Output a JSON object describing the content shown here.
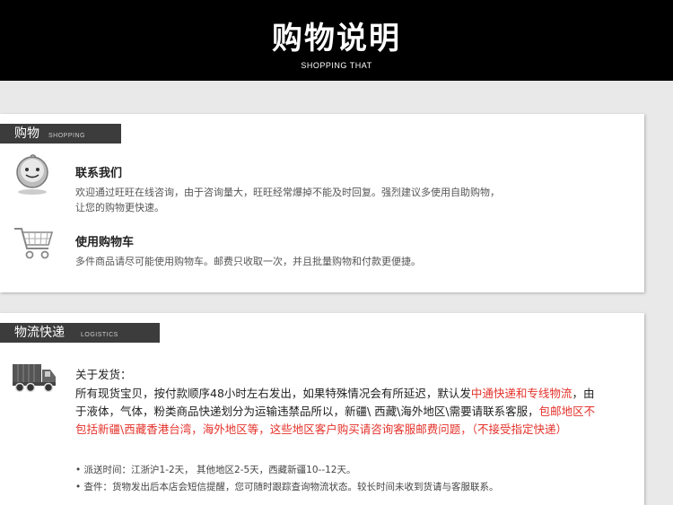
{
  "banner": {
    "title": "购物说明",
    "subtitle": "SHOPPING THAT"
  },
  "shopping": {
    "label_cn": "购物",
    "label_en": "SHOPPING",
    "items": [
      {
        "icon": "chat-bubble-icon",
        "title": "联系我们",
        "lines": [
          "欢迎通过旺旺在线咨询，由于咨询量大，旺旺经常爆掉不能及时回复。强烈建议多使用自助购物，",
          "让您的购物更快速。"
        ]
      },
      {
        "icon": "shopping-cart-icon",
        "title": "使用购物车",
        "lines": [
          "多件商品请尽可能使用购物车。邮费只收取一次，并且批量购物和付款更便捷。"
        ]
      }
    ]
  },
  "logistics": {
    "label_cn": "物流快递",
    "label_en": "LOGISTICS",
    "icon": "delivery-truck-icon",
    "heading": "关于发货：",
    "body": {
      "p1": "所有现货宝贝，按付款顺序48小时左右发出，如果特殊情况会有所延迟，默认发",
      "r1": "中通快递和专线物流",
      "p2": "，由于液体，气体，粉类商品快递划分为运输违禁品所以，新疆\\ 西藏\\海外地区\\需要请联系客服，",
      "r2": "包邮地区不包括新疆\\西藏香港台湾，海外地区等，这些地区客户购买请咨询客服邮费问题，（不接受指定快递）"
    },
    "notes": [
      "• 派送时间：江浙沪1-2天， 其他地区2-5天，西藏新疆10--12天。",
      "• 查件：货物发出后本店会短信提醒，您可随时跟踪查询物流状态。较长时间未收到货请与客服联系。"
    ]
  },
  "colors": {
    "accent_red": "#e4322b",
    "label_bar": "#3c3c3c",
    "banner": "#000000"
  }
}
